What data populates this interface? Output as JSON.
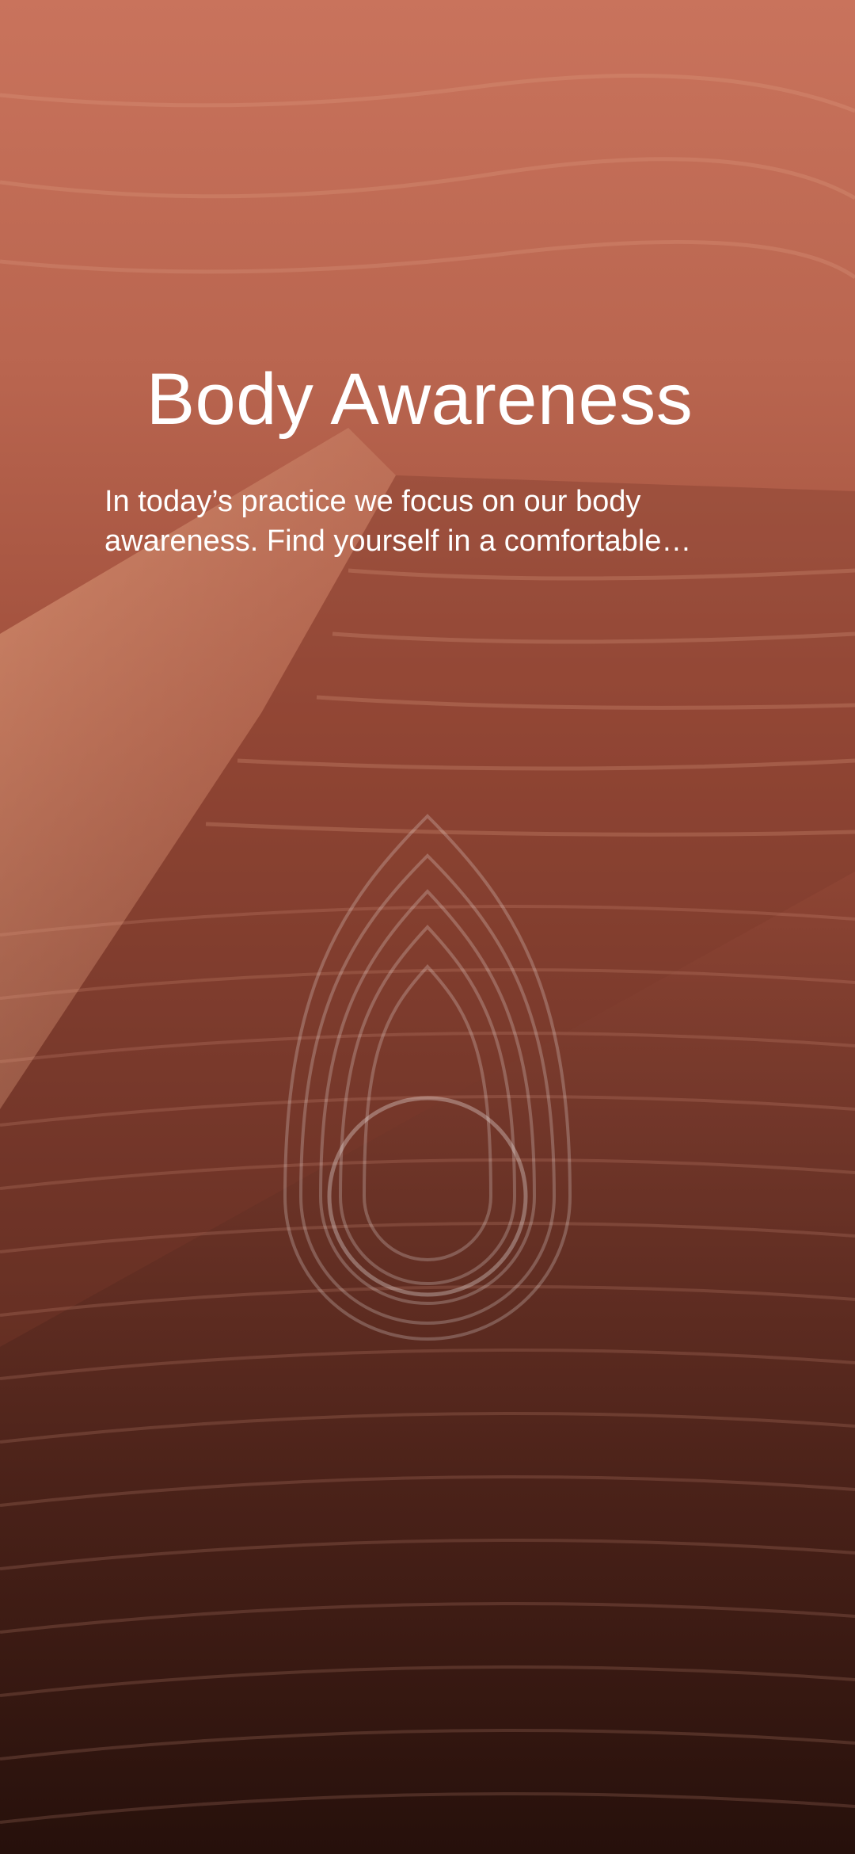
{
  "session": {
    "title": "Body Awareness",
    "description": "In today’s practice we focus on our body awareness. Find yourself in a comfortable position and take a deep breath."
  },
  "theme": {
    "sand_light": "#d9826a",
    "sand_mid": "#a2523f",
    "sand_dark": "#2a120d",
    "text": "#ffffff"
  },
  "icons": {
    "breathing_visual": "droplet-rings-icon"
  }
}
